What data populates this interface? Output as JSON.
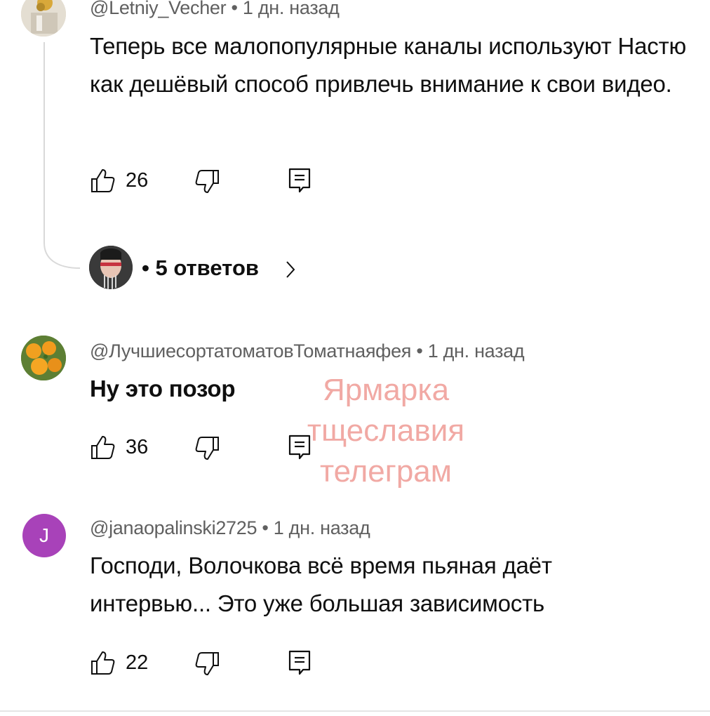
{
  "comments": [
    {
      "author": "@Letniy_Vecher",
      "time": "1 дн. назад",
      "text": "Теперь все малопопулярные каналы используют Настю как дешёвый способ привлечь внимание к свои видео.",
      "likes": "26"
    },
    {
      "author": "@ЛучшиесортатоматовТоматнаяфея",
      "time": "1 дн. назад",
      "text": "Ну это позор",
      "likes": "36"
    },
    {
      "author": "@janaopalinski2725",
      "time": "1 дн. назад",
      "text": "Господи, Волочкова всё время пьяная даёт интервью... Это уже большая зависимость",
      "likes": "22",
      "avatar_letter": "J",
      "avatar_color": "#a842b9"
    }
  ],
  "replies": {
    "label": "5 ответов"
  },
  "separator": "•",
  "watermark": [
    "Ярмарка",
    "тщеславия",
    "телеграм"
  ],
  "icons": {
    "like": "thumbs-up-icon",
    "dislike": "thumbs-down-icon",
    "reply": "comment-icon",
    "expand": "chevron-right-icon"
  }
}
